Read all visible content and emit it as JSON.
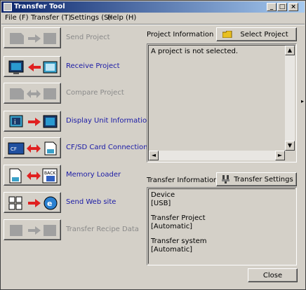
{
  "window": {
    "title": "Transfer Tool"
  },
  "menu": [
    {
      "label": "File (F)"
    },
    {
      "label": "Transfer (T)"
    },
    {
      "label": "Settings (S)"
    },
    {
      "label": "Help (H)"
    }
  ],
  "actions": [
    {
      "label": "Send Project",
      "enabled": false,
      "icon": "send-project-icon"
    },
    {
      "label": "Receive Project",
      "enabled": true,
      "icon": "receive-project-icon"
    },
    {
      "label": "Compare Project",
      "enabled": false,
      "icon": "compare-project-icon"
    },
    {
      "label": "Display Unit Information",
      "enabled": true,
      "icon": "display-unit-info-icon"
    },
    {
      "label": "CF/SD Card Connection",
      "enabled": true,
      "icon": "cf-sd-card-icon"
    },
    {
      "label": "Memory Loader",
      "enabled": true,
      "icon": "memory-loader-icon"
    },
    {
      "label": "Send Web site",
      "enabled": true,
      "icon": "send-web-site-icon"
    },
    {
      "label": "Transfer Recipe Data",
      "enabled": false,
      "icon": "transfer-recipe-icon"
    }
  ],
  "project_info": {
    "label": "Project Information",
    "select_button": "Select Project",
    "text": "A project is not selected."
  },
  "transfer_info": {
    "label": "Transfer Information",
    "settings_button": "Transfer Settings",
    "device_label": "Device",
    "device_value": "[USB]",
    "project_label": "Transfer Project",
    "project_value": "[Automatic]",
    "system_label": "Transfer system",
    "system_value": "[Automatic]"
  },
  "close_button": "Close"
}
